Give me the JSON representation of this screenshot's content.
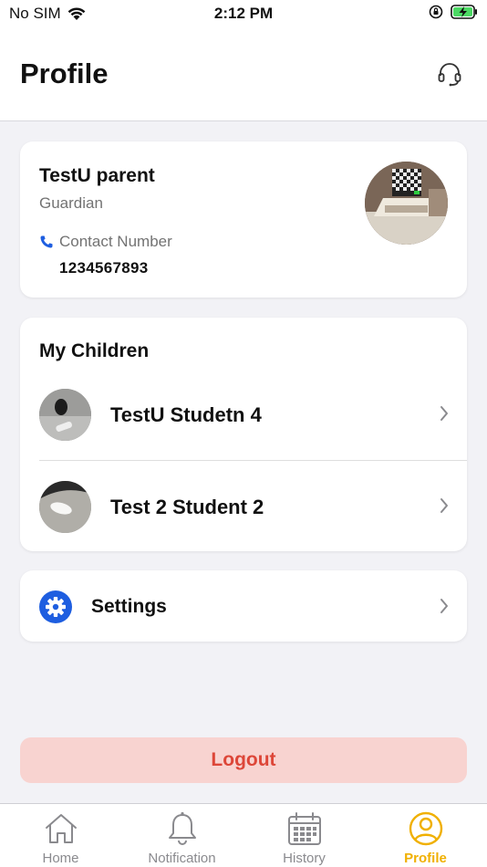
{
  "status_bar": {
    "carrier": "No SIM",
    "time": "2:12 PM"
  },
  "header": {
    "title": "Profile",
    "support_icon": "headset-icon"
  },
  "profile": {
    "name": "TestU parent",
    "role": "Guardian",
    "contact_label": "Contact Number",
    "phone": "1234567893"
  },
  "children": {
    "title": "My Children",
    "items": [
      {
        "name": "TestU Studetn 4"
      },
      {
        "name": "Test 2 Student 2"
      }
    ]
  },
  "settings": {
    "label": "Settings",
    "icon": "gear-icon"
  },
  "logout_label": "Logout",
  "tabs": [
    {
      "label": "Home",
      "icon": "home-icon"
    },
    {
      "label": "Notification",
      "icon": "bell-icon"
    },
    {
      "label": "History",
      "icon": "calendar-icon"
    },
    {
      "label": "Profile",
      "icon": "user-circle-icon",
      "active": true
    }
  ],
  "colors": {
    "accent": "#f0b000",
    "primary_blue": "#1e5ee0",
    "logout_bg": "#f8d3d0",
    "logout_text": "#dd4638"
  }
}
